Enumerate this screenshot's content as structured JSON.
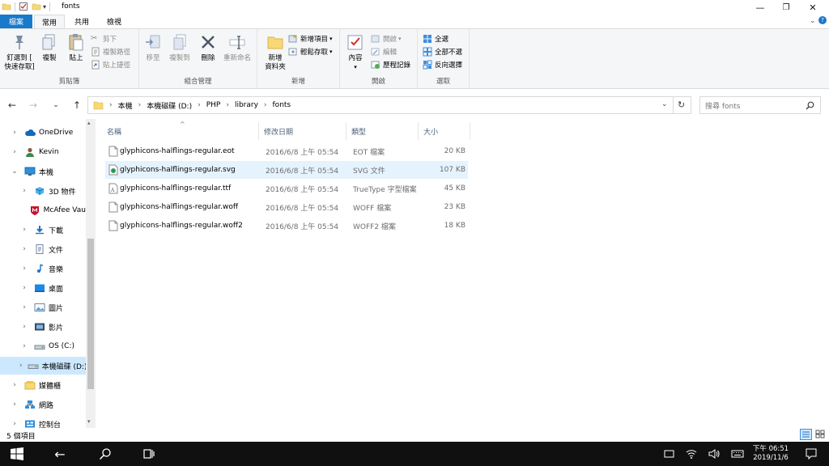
{
  "window": {
    "title": "fonts",
    "controls": [
      "minimize",
      "maximize",
      "close"
    ]
  },
  "ribbon_tabs": [
    {
      "label": "檔案",
      "active": false,
      "is_file": true
    },
    {
      "label": "常用",
      "active": true
    },
    {
      "label": "共用",
      "active": false
    },
    {
      "label": "檢視",
      "active": false
    }
  ],
  "ribbon": {
    "clipboard": {
      "label": "剪貼簿",
      "pin_quick": "釘選到 [\n快速存取]",
      "copy": "複製",
      "paste": "貼上",
      "cut": "剪下",
      "copy_path": "複製路徑",
      "paste_shortcut": "貼上捷徑"
    },
    "organize": {
      "label": "組合管理",
      "move_to": "移至",
      "copy_to": "複製到",
      "delete": "刪除",
      "rename": "重新命名"
    },
    "new": {
      "label": "新增",
      "new_folder": "新增\n資料夾",
      "new_item": "新增項目",
      "easy_access": "輕鬆存取"
    },
    "open": {
      "label": "開啟",
      "properties": "內容",
      "open": "開啟",
      "edit": "編輯",
      "history": "歷程記錄"
    },
    "select": {
      "label": "選取",
      "select_all": "全選",
      "select_none": "全部不選",
      "invert": "反向選擇"
    }
  },
  "address": {
    "crumbs": [
      "本機",
      "本機磁碟 (D:)",
      "PHP",
      "library",
      "fonts"
    ],
    "search_placeholder": "搜尋 fonts"
  },
  "nav_pane": [
    {
      "label": "OneDrive",
      "icon": "cloud-icon",
      "chev": "›",
      "indent": 0,
      "selected": false
    },
    {
      "label": "Kevin",
      "icon": "user-icon",
      "chev": "›",
      "indent": 0,
      "selected": false
    },
    {
      "label": "本機",
      "icon": "pc-icon",
      "chev": "⌄",
      "indent": 0,
      "selected": false
    },
    {
      "label": "3D 物件",
      "icon": "3d-objects-icon",
      "chev": "›",
      "indent": 1,
      "selected": false
    },
    {
      "label": "McAfee Vau",
      "icon": "mcafee-icon",
      "chev": "",
      "indent": 1,
      "selected": false
    },
    {
      "label": "下載",
      "icon": "download-icon",
      "chev": "›",
      "indent": 1,
      "selected": false
    },
    {
      "label": "文件",
      "icon": "documents-icon",
      "chev": "›",
      "indent": 1,
      "selected": false
    },
    {
      "label": "音樂",
      "icon": "music-icon",
      "chev": "›",
      "indent": 1,
      "selected": false
    },
    {
      "label": "桌面",
      "icon": "desktop-icon",
      "chev": "›",
      "indent": 1,
      "selected": false
    },
    {
      "label": "圖片",
      "icon": "pictures-icon",
      "chev": "›",
      "indent": 1,
      "selected": false
    },
    {
      "label": "影片",
      "icon": "videos-icon",
      "chev": "›",
      "indent": 1,
      "selected": false
    },
    {
      "label": "OS (C:)",
      "icon": "drive-icon",
      "chev": "›",
      "indent": 1,
      "selected": false
    },
    {
      "label": "本機磁碟 (D:)",
      "icon": "drive-icon",
      "chev": "›",
      "indent": 1,
      "selected": true
    },
    {
      "label": "媒體櫃",
      "icon": "libraries-icon",
      "chev": "›",
      "indent": 0,
      "selected": false
    },
    {
      "label": "網路",
      "icon": "network-icon",
      "chev": "›",
      "indent": 0,
      "selected": false
    },
    {
      "label": "控制台",
      "icon": "control-panel-icon",
      "chev": "›",
      "indent": 0,
      "selected": false
    }
  ],
  "columns": {
    "name": "名稱",
    "date": "修改日期",
    "type": "類型",
    "size": "大小"
  },
  "files": [
    {
      "name": "glyphicons-halflings-regular.eot",
      "date": "2016/6/8 上午 05:54",
      "type": "EOT 檔案",
      "size": "20 KB",
      "icon": "file-icon",
      "hover": false
    },
    {
      "name": "glyphicons-halflings-regular.svg",
      "date": "2016/6/8 上午 05:54",
      "type": "SVG 文件",
      "size": "107 KB",
      "icon": "svg-file-icon",
      "hover": true
    },
    {
      "name": "glyphicons-halflings-regular.ttf",
      "date": "2016/6/8 上午 05:54",
      "type": "TrueType 字型檔案",
      "size": "45 KB",
      "icon": "font-file-icon",
      "hover": false
    },
    {
      "name": "glyphicons-halflings-regular.woff",
      "date": "2016/6/8 上午 05:54",
      "type": "WOFF 檔案",
      "size": "23 KB",
      "icon": "file-icon",
      "hover": false
    },
    {
      "name": "glyphicons-halflings-regular.woff2",
      "date": "2016/6/8 上午 05:54",
      "type": "WOFF2 檔案",
      "size": "18 KB",
      "icon": "file-icon",
      "hover": false
    }
  ],
  "status": {
    "item_count": "5 個項目"
  },
  "taskbar": {
    "time": "下午 06:51",
    "date": "2019/11/6"
  },
  "colors": {
    "file_tab": "#1979ca",
    "selection": "#cce8ff",
    "hover": "#e5f3ff",
    "taskbar": "#101010"
  }
}
